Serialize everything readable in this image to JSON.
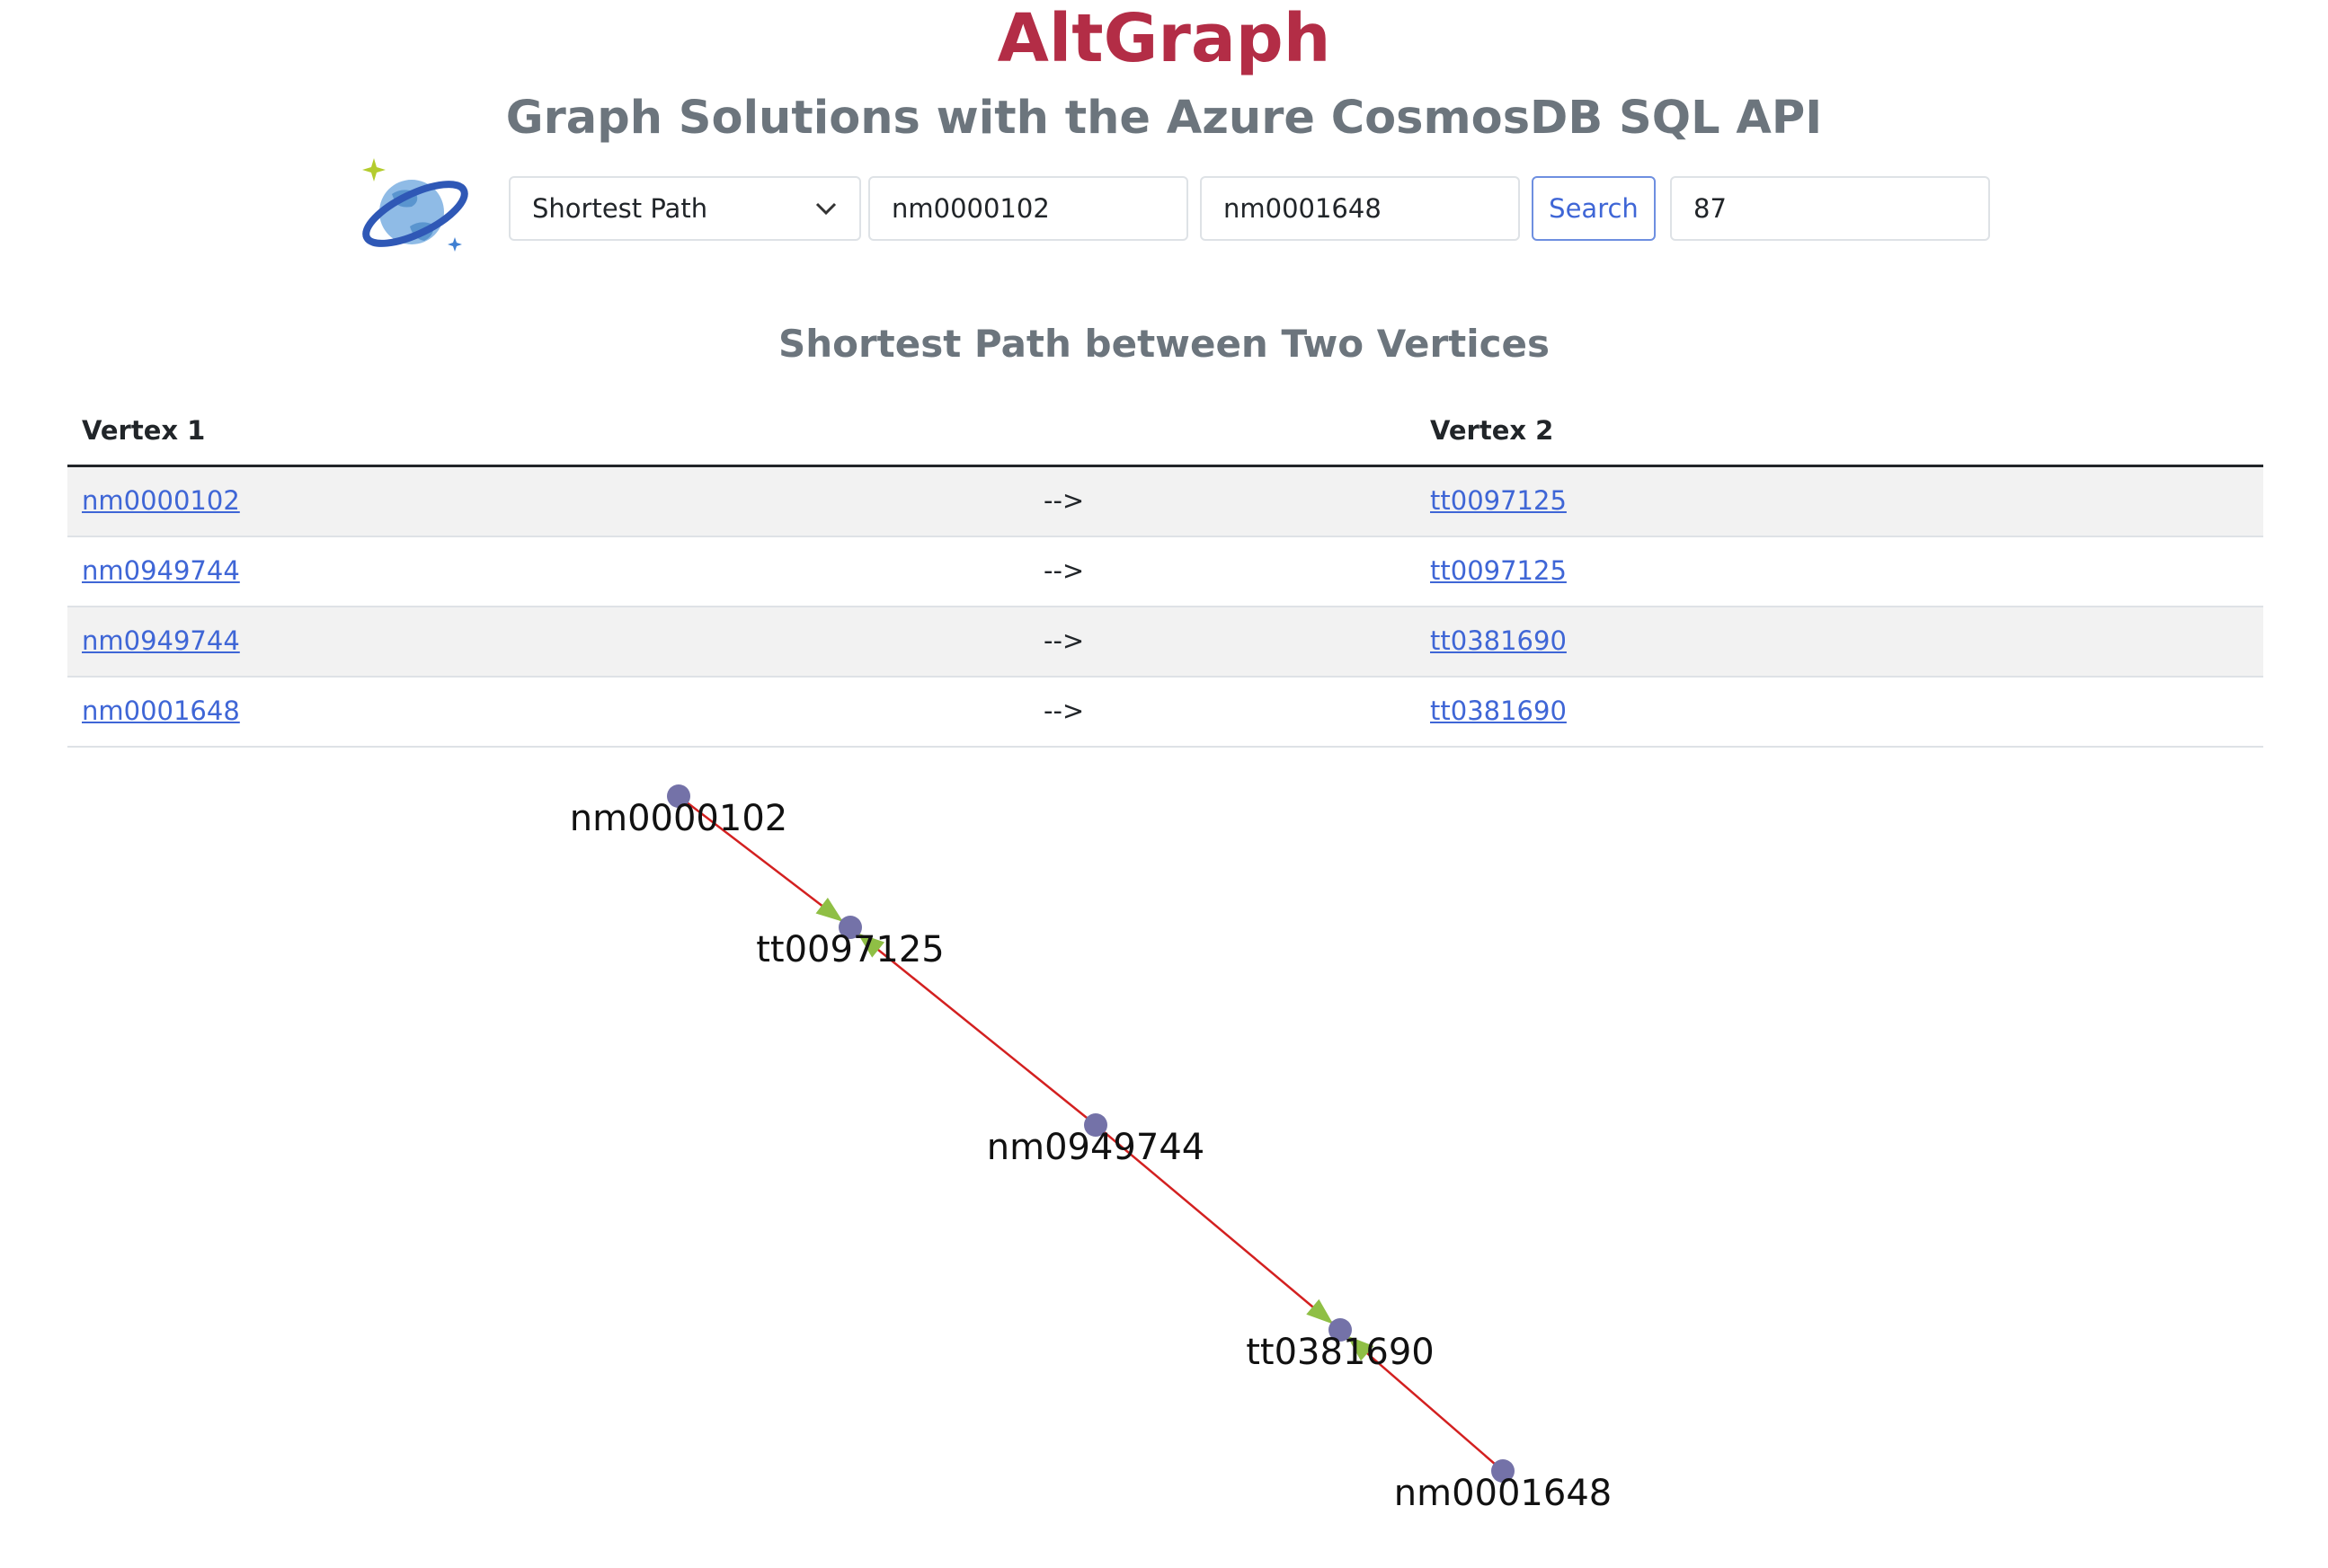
{
  "header": {
    "title": "AltGraph",
    "subtitle": "Graph Solutions with the Azure CosmosDB SQL API"
  },
  "toolbar": {
    "query_type": "Shortest Path",
    "vertex1_value": "nm0000102",
    "vertex2_value": "nm0001648",
    "search_label": "Search",
    "extra_value": "87"
  },
  "results": {
    "title": "Shortest Path between Two Vertices",
    "columns": [
      "Vertex 1",
      "",
      "Vertex 2"
    ],
    "rows": [
      {
        "v1": "nm0000102",
        "arrow": "-->",
        "v2": "tt0097125"
      },
      {
        "v1": "nm0949744",
        "arrow": "-->",
        "v2": "tt0097125"
      },
      {
        "v1": "nm0949744",
        "arrow": "-->",
        "v2": "tt0381690"
      },
      {
        "v1": "nm0001648",
        "arrow": "-->",
        "v2": "tt0381690"
      }
    ]
  },
  "graph": {
    "nodes": [
      "nm0000102",
      "tt0097125",
      "nm0949744",
      "tt0381690",
      "nm0001648"
    ],
    "edges": [
      [
        "nm0000102",
        "tt0097125"
      ],
      [
        "tt0097125",
        "nm0949744"
      ],
      [
        "nm0949744",
        "tt0381690"
      ],
      [
        "tt0381690",
        "nm0001648"
      ]
    ],
    "colors": {
      "node": "#7472a8",
      "edge": "#d32020",
      "arrow": "#8fbf45"
    }
  }
}
